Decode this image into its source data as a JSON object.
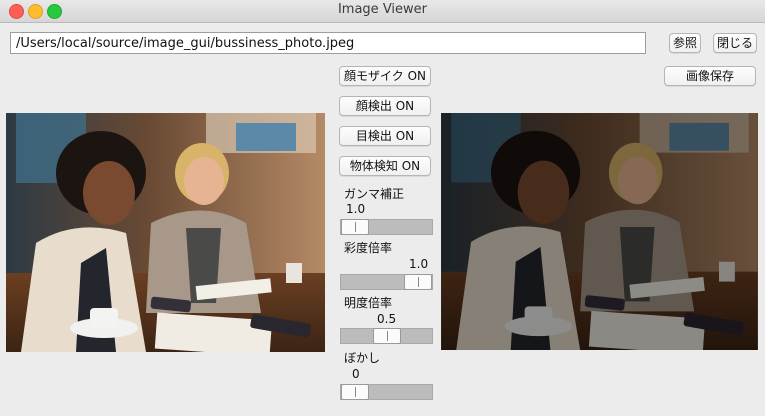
{
  "window": {
    "title": "Image Viewer"
  },
  "toolbar": {
    "path_value": "/Users/local/source/image_gui/bussiness_photo.jpeg",
    "browse_label": "参照",
    "close_label": "閉じる",
    "save_label": "画像保存"
  },
  "controls": {
    "face_mosaic_label": "顔モザイク ON",
    "face_detect_label": "顔検出 ON",
    "eye_detect_label": "目検出 ON",
    "object_detect_label": "物体検知 ON",
    "gamma": {
      "label": "ガンマ補正",
      "value": "1.0",
      "level": 0.0
    },
    "saturation": {
      "label": "彩度倍率",
      "value": "1.0",
      "level": 1.0
    },
    "brightness": {
      "label": "明度倍率",
      "value": "0.5",
      "level": 0.5
    },
    "blur": {
      "label": "ぼかし",
      "value": "0",
      "level": 0.0
    }
  },
  "colors": {
    "close": "#fd5f57",
    "minimize": "#febc2e",
    "maximize": "#28c840"
  }
}
